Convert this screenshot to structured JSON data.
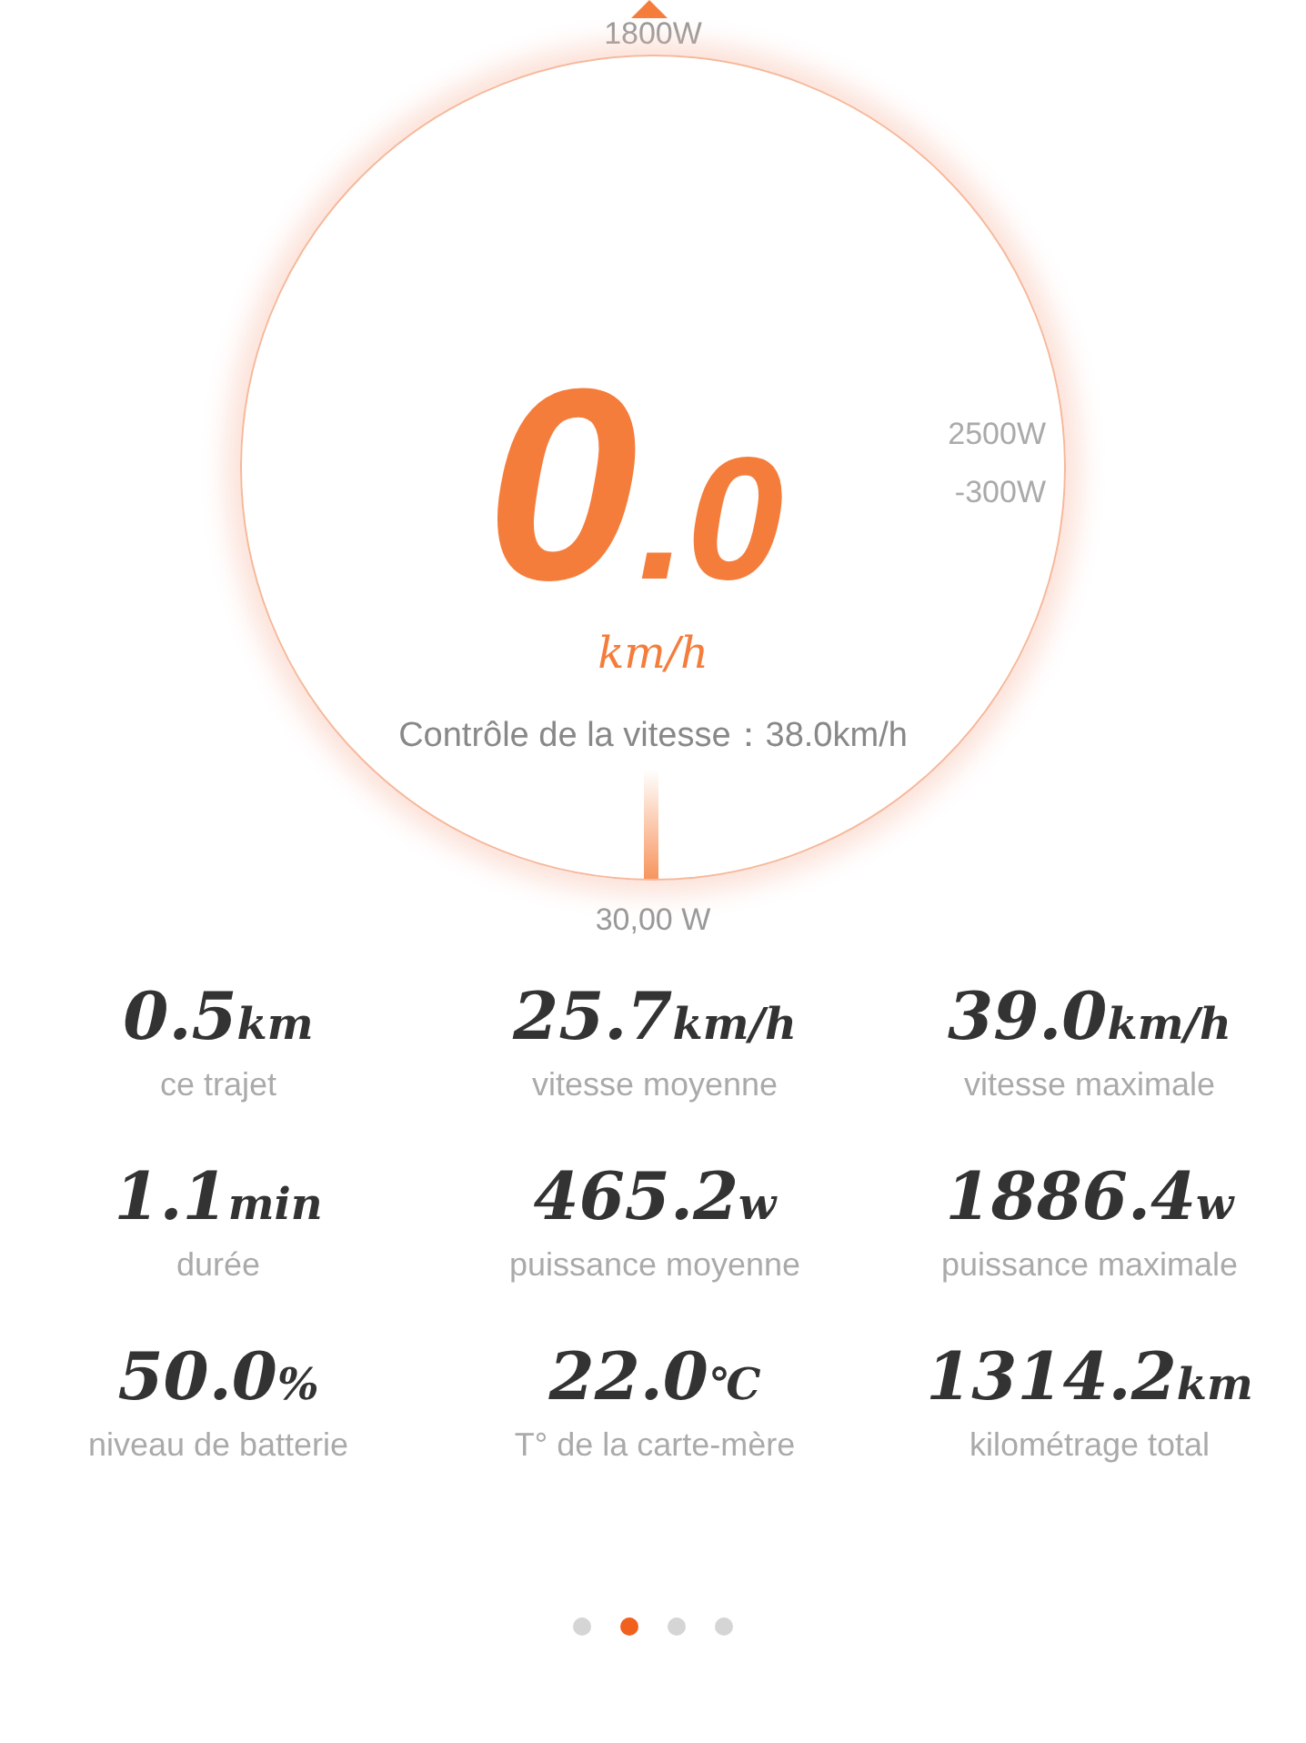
{
  "gauge": {
    "top_label": "1800W",
    "right_labels": [
      "2500W",
      "-300W"
    ],
    "speed_whole": "0",
    "speed_decimal": ".0",
    "unit": "km/h",
    "speed_control": "Contrôle de la vitesse：38.0km/h",
    "bottom_label": "30,00 W"
  },
  "stats": [
    {
      "value": "0.5",
      "unit": "km",
      "label": "ce trajet"
    },
    {
      "value": "25.7",
      "unit": "km/h",
      "label": "vitesse moyenne"
    },
    {
      "value": "39.0",
      "unit": "km/h",
      "label": "vitesse maximale"
    },
    {
      "value": "1.1",
      "unit": "min",
      "label": "durée"
    },
    {
      "value": "465.2",
      "unit": "w",
      "label": "puissance moyenne"
    },
    {
      "value": "1886.4",
      "unit": "w",
      "label": "puissance maximale"
    },
    {
      "value": "50.0",
      "unit": "%",
      "label": "niveau de batterie"
    },
    {
      "value": "22.0",
      "unit": "℃",
      "label": "T° de la carte-mère"
    },
    {
      "value": "1314.2",
      "unit": "km",
      "label": "kilométrage total"
    }
  ],
  "pages": [
    {
      "selected": false
    },
    {
      "selected": true
    },
    {
      "selected": false
    },
    {
      "selected": false
    }
  ]
}
